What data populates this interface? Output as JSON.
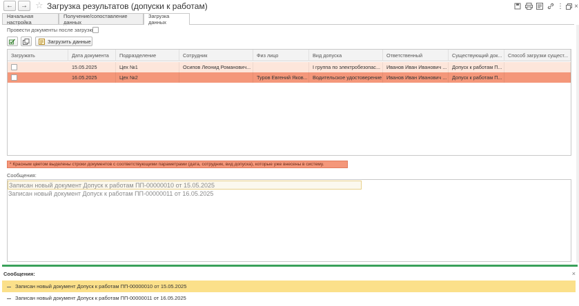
{
  "window": {
    "title": "Загрузка результатов (допуски к работам)",
    "back_icon": "arrow-left-icon",
    "forward_icon": "arrow-right-icon",
    "favorite_icon": "star-icon",
    "top_icons": [
      "save-icon",
      "print-icon",
      "preview-icon",
      "link-icon",
      "more-icon",
      "restore-icon",
      "close-icon"
    ]
  },
  "tabs": [
    {
      "label": "Начальная настройка",
      "active": false
    },
    {
      "label": "Получение/сопоставление данных",
      "active": false
    },
    {
      "label": "Загрузка данных",
      "active": true
    }
  ],
  "options": {
    "post_docs_label": "Провести документы после загрузки:",
    "post_docs_checked": false
  },
  "toolbar": {
    "btn1_icon": "check-all-icon",
    "btn2_icon": "copy-icon",
    "load_label": "Загрузить данные",
    "load_icon": "load-icon"
  },
  "table": {
    "columns": [
      "Загружать",
      "Дата документа",
      "Подразделение",
      "Сотрудник",
      "Физ лицо",
      "Вид допуска",
      "Ответственный",
      "Существующий док...",
      "Способ загрузки сущест..."
    ],
    "rows": [
      {
        "load": false,
        "date": "15.05.2025",
        "dept": "Цех №1",
        "employee": "Осипов Леонид Романович...",
        "person": "",
        "type": "I группа по электробезопас...",
        "responsible": "Иванов Иван Иванович ...",
        "existing": "Допуск к работам П...",
        "method": ""
      },
      {
        "load": false,
        "date": "16.05.2025",
        "dept": "Цех №2",
        "employee": "",
        "person": "Туров Евгений Яков...",
        "type": "Водительское удостоверение",
        "responsible": "Иванов Иван Иванович ...",
        "existing": "Допуск к работам П...",
        "method": ""
      }
    ]
  },
  "note": "* Красным цветом выделены строки документов  с соответствующими параметрами (дата, сотрудник, вид допуска), которые уже внесены в систему.",
  "messages_section": {
    "label": "Сообщения:",
    "lines": [
      "Записан новый документ Допуск к работам ПП-00000010 от 15.05.2025",
      "Записан новый документ Допуск к работам ПП-00000011 от 16.05.2025"
    ]
  },
  "bottom_panel": {
    "title": "Сообщения:",
    "close_symbol": "×",
    "messages": [
      "Записан новый документ Допуск к работам ПП-00000010 от 15.05.2025",
      "Записан новый документ Допуск к работам ПП-00000011 от 16.05.2025"
    ]
  },
  "colors": {
    "row1_bg": "#fde6db",
    "row2_bg": "#f4977a",
    "highlight": "#fbe08a",
    "green": "#3aa15a"
  }
}
